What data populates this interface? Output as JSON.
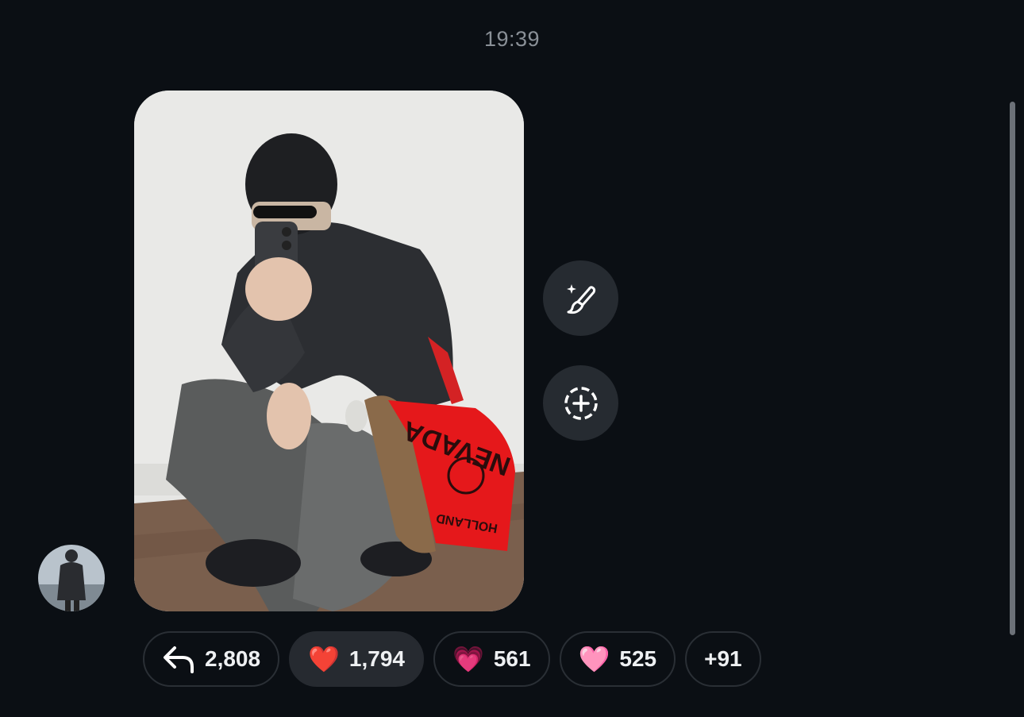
{
  "message": {
    "timestamp": "19:39",
    "photo_bag_text": "NEVADA",
    "photo_bag_subtext": "HOLLAND"
  },
  "actions": {
    "edit_icon": "magic-brush-icon",
    "add_icon": "add-story-icon"
  },
  "reactions": [
    {
      "icon": "reply-icon",
      "emoji": "",
      "count": "2,808"
    },
    {
      "icon": "red-heart",
      "emoji": "❤️",
      "count": "1,794"
    },
    {
      "icon": "sparkling-heart",
      "emoji": "💗",
      "count": "561"
    },
    {
      "icon": "pink-heart",
      "emoji": "🩷",
      "count": "525"
    },
    {
      "icon": "",
      "emoji": "",
      "count": "+91"
    }
  ],
  "colors": {
    "background": "#0b0f14",
    "pill_active": "#262a30",
    "button_bg": "#262b31"
  }
}
